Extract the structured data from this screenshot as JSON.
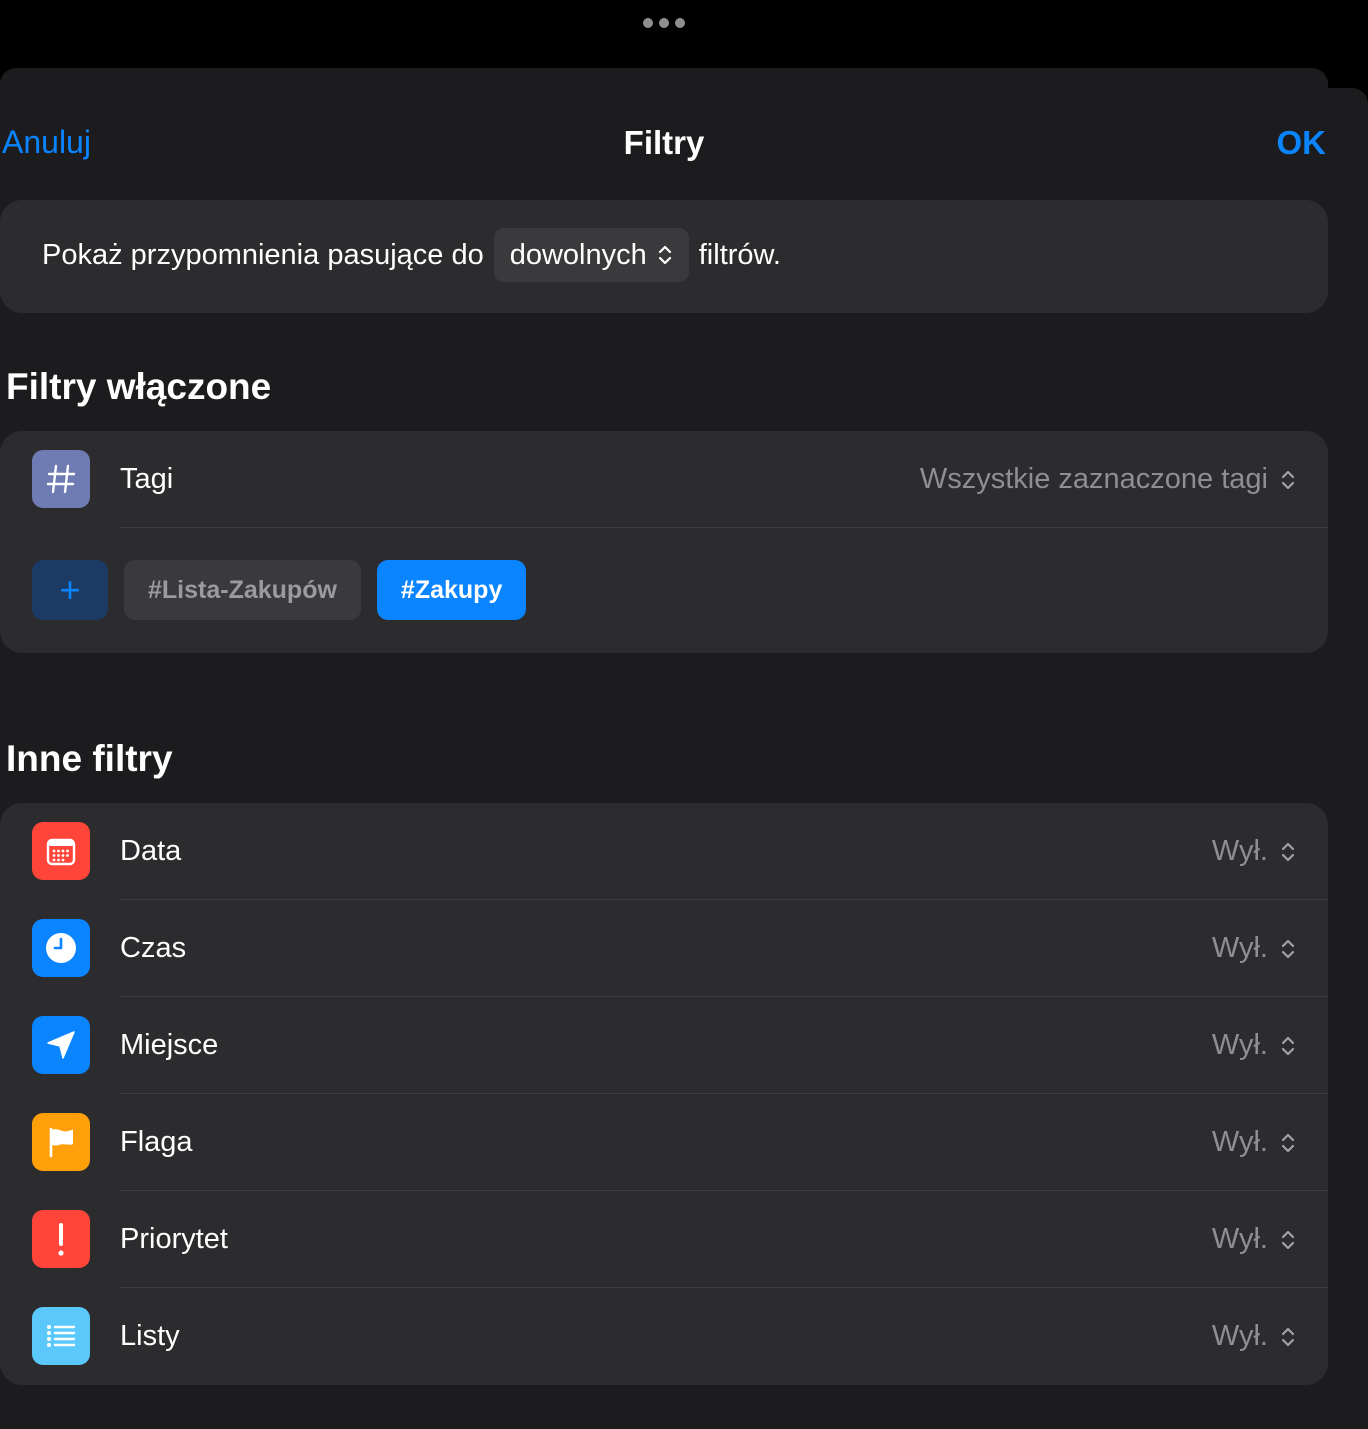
{
  "header": {
    "cancel_label": "Anuluj",
    "title": "Filtry",
    "ok_label": "OK"
  },
  "match": {
    "prefix": "Pokaż przypomnienia pasujące do",
    "selected": "dowolnych",
    "suffix": "filtrów."
  },
  "enabled_section": {
    "title": "Filtry włączone",
    "tags_row": {
      "label": "Tagi",
      "value": "Wszystkie zaznaczone tagi",
      "icon": "hashtag-icon",
      "color": "#6e7cb3"
    },
    "add_label": "+",
    "tags": [
      {
        "label": "#Lista-Zakupów",
        "selected": false
      },
      {
        "label": "#Zakupy",
        "selected": true
      }
    ]
  },
  "other_section": {
    "title": "Inne filtry",
    "rows": [
      {
        "label": "Data",
        "value": "Wył.",
        "icon": "calendar-icon",
        "color": "#ff453a"
      },
      {
        "label": "Czas",
        "value": "Wył.",
        "icon": "clock-icon",
        "color": "#0a84ff"
      },
      {
        "label": "Miejsce",
        "value": "Wył.",
        "icon": "location-arrow-icon",
        "color": "#0a84ff"
      },
      {
        "label": "Flaga",
        "value": "Wył.",
        "icon": "flag-icon",
        "color": "#ff9f0a"
      },
      {
        "label": "Priorytet",
        "value": "Wył.",
        "icon": "exclamation-icon",
        "color": "#ff453a"
      },
      {
        "label": "Listy",
        "value": "Wył.",
        "icon": "list-icon",
        "color": "#5ac8fa"
      }
    ]
  }
}
